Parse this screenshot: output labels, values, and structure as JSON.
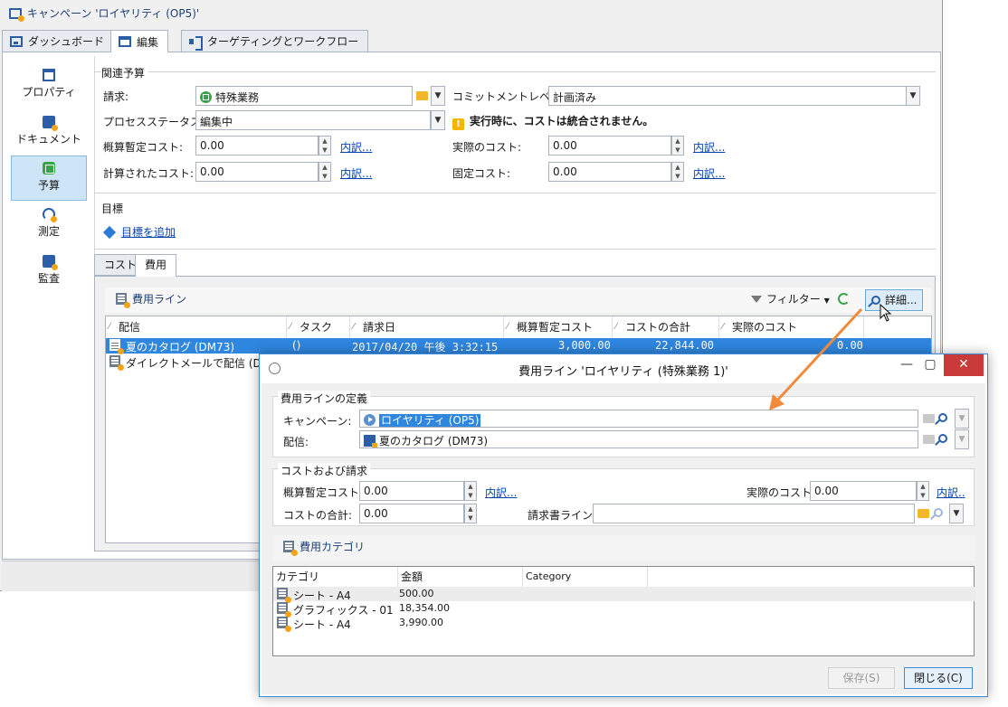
{
  "window": {
    "title": "キャンペーン 'ロイヤリティ (OP5)'",
    "tabs": [
      "ダッシュボード",
      "編集",
      "ターゲティングとワークフロー"
    ]
  },
  "nav": {
    "items": [
      {
        "label": "プロパティ",
        "icon": "properties-icon"
      },
      {
        "label": "ドキュメント",
        "icon": "document-icon"
      },
      {
        "label": "予算",
        "icon": "budget-icon",
        "active": true
      },
      {
        "label": "測定",
        "icon": "measure-icon"
      },
      {
        "label": "監査",
        "icon": "audit-icon"
      }
    ]
  },
  "budget": {
    "group_title": "関連予算",
    "invoice_label": "請求:",
    "invoice_value": "特殊業務",
    "commitment_label": "コミットメントレベル:",
    "commitment_value": "計画済み",
    "process_label": "プロセスステータス:",
    "process_value": "編集中",
    "warning": "実行時に、コストは統合されません。",
    "estimated_label": "概算暫定コスト:",
    "estimated_value": "0.00",
    "actual_label": "実際のコスト:",
    "actual_value": "0.00",
    "calculated_label": "計算されたコスト:",
    "calculated_value": "0.00",
    "fixed_label": "固定コスト:",
    "fixed_value": "0.00",
    "breakdown_link": "内訳..."
  },
  "objectives": {
    "title": "目標",
    "add_link": "目標を追加"
  },
  "subtabs": [
    "コスト",
    "費用"
  ],
  "expenses": {
    "toolbar_title": "費用ライン",
    "filter_label": "フィルター",
    "detail_label": "詳細...",
    "columns": [
      "配信",
      "タスク",
      "請求日",
      "概算暫定コスト",
      "コストの合計",
      "実際のコスト"
    ],
    "rows": [
      {
        "delivery": "夏のカタログ (DM73)",
        "task": "()",
        "date": "2017/04/20 午後 3:32:15",
        "estimated": "3,000.00",
        "total": "22,844.00",
        "actual": "0.00",
        "selected": true
      },
      {
        "delivery": "ダイレクトメールで配信 (DM",
        "task": "",
        "date": "",
        "estimated": "",
        "total": "",
        "actual": "",
        "selected": false
      }
    ]
  },
  "dialog": {
    "title": "費用ライン 'ロイヤリティ (特殊業務 1)'",
    "definition_title": "費用ラインの定義",
    "campaign_label": "キャンペーン:",
    "campaign_value": "ロイヤリティ (OP5)",
    "delivery_label": "配信:",
    "delivery_value": "夏のカタログ (DM73)",
    "cost_group_title": "コストおよび請求",
    "estimated_label": "概算暫定コスト:",
    "estimated_value": "0.00",
    "actual_label": "実際のコスト:",
    "actual_value": "0.00",
    "total_label": "コストの合計:",
    "total_value": "0.00",
    "invoice_line_label": "請求書ライン:",
    "invoice_line_value": "",
    "breakdown_link": "内訳...",
    "breakdown_link_short": "内訳..",
    "categories_title": "費用カテゴリ",
    "cat_columns": [
      "カテゴリ",
      "金額",
      "Category"
    ],
    "cat_rows": [
      {
        "category": "シート - A4",
        "amount": "500.00"
      },
      {
        "category": "グラフィックス - 01",
        "amount": "18,354.00"
      },
      {
        "category": "シート - A4",
        "amount": "3,990.00"
      }
    ],
    "save_label": "保存(S)",
    "close_label": "閉じる(C)"
  },
  "colors": {
    "accent": "#2f86de",
    "link": "#0645ad",
    "arrow": "#f08a3c",
    "close_button": "#c93a3a"
  }
}
